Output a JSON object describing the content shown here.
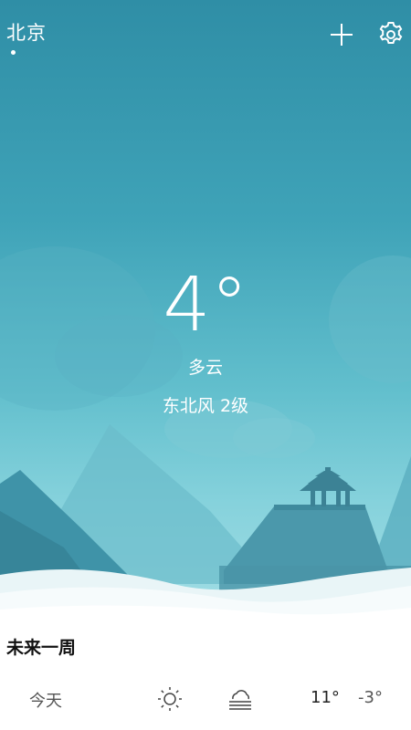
{
  "header": {
    "city": "北京"
  },
  "current": {
    "temperature": "4°",
    "condition": "多云",
    "wind": "东北风 2级"
  },
  "icons": {
    "add": "plus-icon",
    "settings": "gear-icon",
    "forecast_day": "sun-icon",
    "forecast_night": "fog-icon"
  },
  "colors": {
    "sky_top": "#2f8ea6",
    "sky_bottom": "#a5dfe6",
    "text_primary": "#ffffff"
  },
  "forecast": {
    "title": "未来一周",
    "rows": [
      {
        "day": "今天",
        "high": "11°",
        "low": "-3°"
      }
    ]
  }
}
